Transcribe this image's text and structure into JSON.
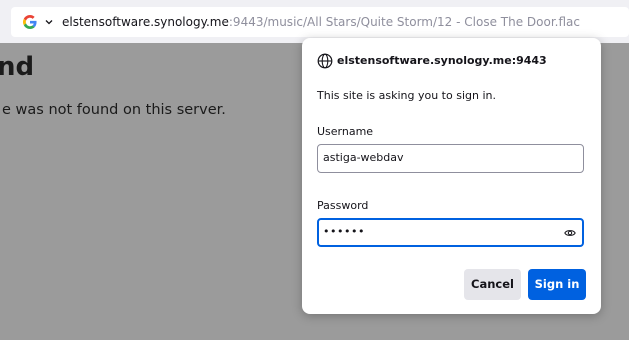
{
  "browser": {
    "url_host": "elstensoftware.synology.me",
    "url_rest": ":9443/music/All Stars/Quite Storm/12 - Close The Door.flac",
    "search_engine_icon": "google-icon"
  },
  "page": {
    "heading": "nd",
    "message": "e was not found on this server."
  },
  "dialog": {
    "origin": "elstensoftware.synology.me:9443",
    "prompt": "This site is asking you to sign in.",
    "username_label": "Username",
    "username_value": "astiga-webdav",
    "password_label": "Password",
    "password_value": "••••••",
    "cancel_label": "Cancel",
    "signin_label": "Sign in"
  },
  "colors": {
    "accent": "#0061e0",
    "overlay": "#9b9b9b"
  }
}
